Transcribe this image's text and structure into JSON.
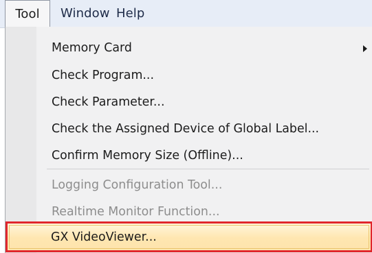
{
  "menubar": {
    "items": [
      {
        "label": "Tool"
      },
      {
        "label": "Window"
      },
      {
        "label": "Help"
      }
    ]
  },
  "dropdown": {
    "items": [
      {
        "label": "Memory Card",
        "submenu": true,
        "enabled": true
      },
      {
        "label": "Check Program...",
        "enabled": true
      },
      {
        "label": "Check Parameter...",
        "enabled": true
      },
      {
        "label": "Check the Assigned Device of Global Label...",
        "enabled": true
      },
      {
        "label": "Confirm Memory Size (Offline)...",
        "enabled": true
      },
      {
        "label": "Logging Configuration Tool...",
        "enabled": false
      },
      {
        "label": "Realtime Monitor Function...",
        "enabled": false
      },
      {
        "label": "GX VideoViewer...",
        "enabled": true,
        "highlighted": true
      }
    ]
  },
  "colors": {
    "highlight_border": "#e0262c",
    "highlight_fill": "#ffe6b0",
    "menubar_bg": "#e7edf7",
    "disabled_text": "#8d8d8d"
  }
}
